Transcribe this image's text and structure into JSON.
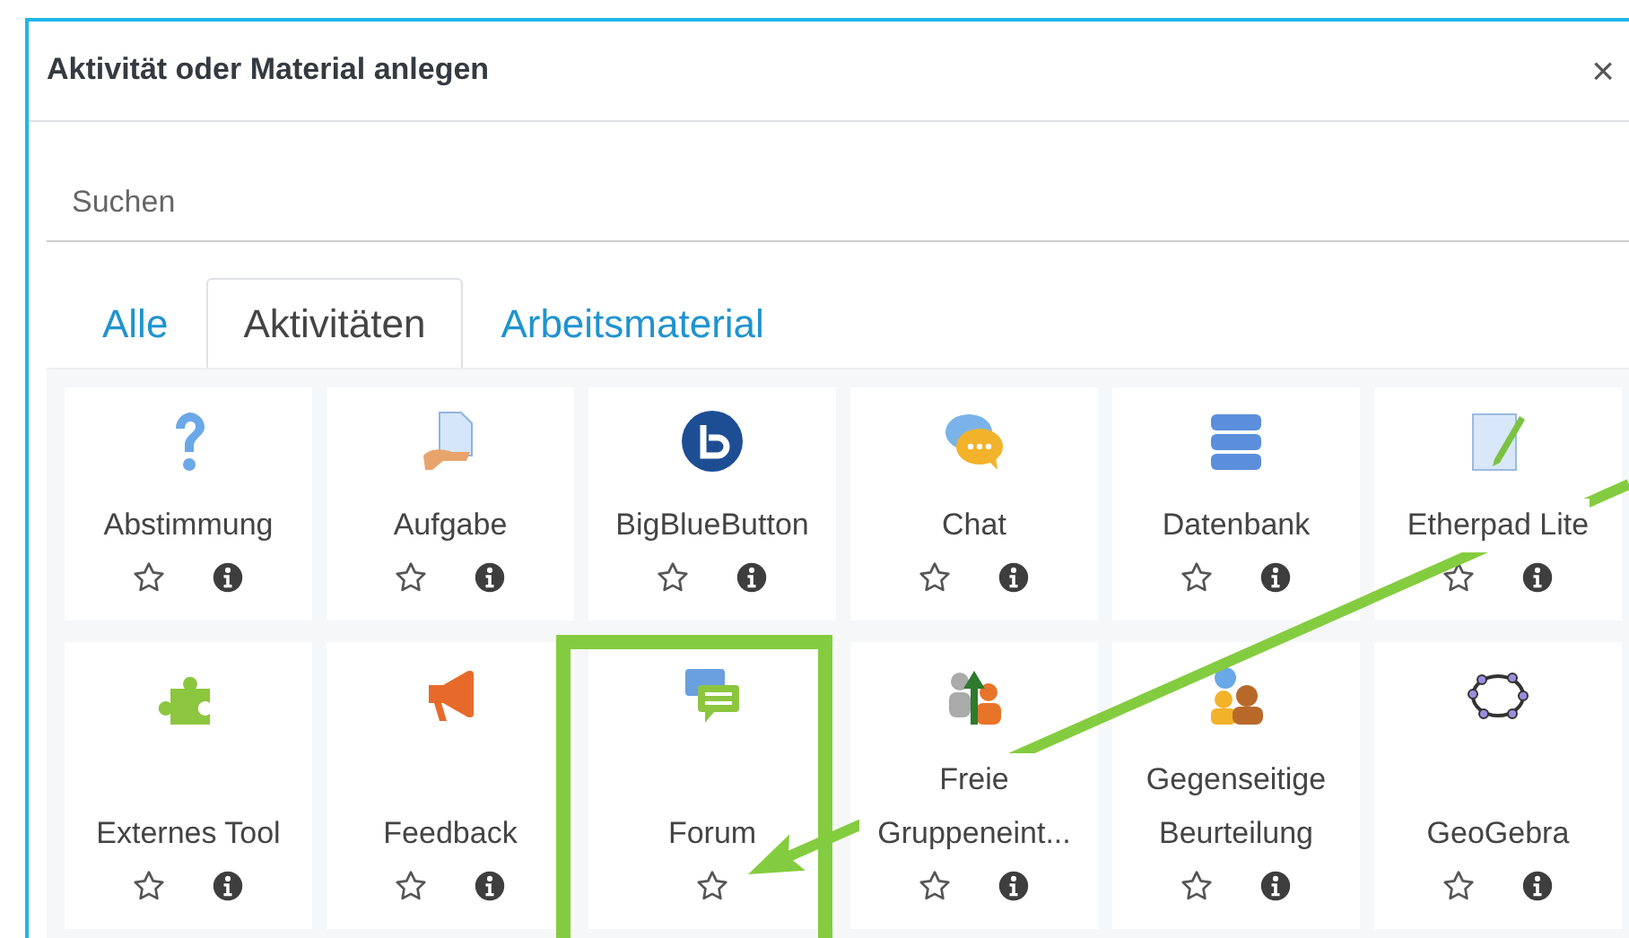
{
  "dialog": {
    "title": "Aktivität oder Material anlegen",
    "close": "×"
  },
  "search": {
    "placeholder": "Suchen"
  },
  "tabs": [
    {
      "label": "Alle",
      "selected": false
    },
    {
      "label": "Aktivitäten",
      "selected": true
    },
    {
      "label": "Arbeitsmaterial",
      "selected": false
    }
  ],
  "items": [
    {
      "label": "Abstimmung",
      "kind": "question",
      "info": true,
      "highlighted": false
    },
    {
      "label": "Aufgabe",
      "kind": "assign",
      "info": true,
      "highlighted": false
    },
    {
      "label": "BigBlueButton",
      "kind": "bbb",
      "info": true,
      "highlighted": false
    },
    {
      "label": "Chat",
      "kind": "chat",
      "info": true,
      "highlighted": false
    },
    {
      "label": "Datenbank",
      "kind": "database",
      "info": true,
      "highlighted": false
    },
    {
      "label": "Etherpad Lite",
      "kind": "etherpad",
      "info": true,
      "highlighted": false
    },
    {
      "label": "Externes Tool",
      "kind": "puzzle",
      "info": true,
      "highlighted": false
    },
    {
      "label": "Feedback",
      "kind": "megaphone",
      "info": true,
      "highlighted": false
    },
    {
      "label": "Forum",
      "kind": "forum",
      "info": false,
      "highlighted": true
    },
    {
      "label": "Freie Gruppeneint...",
      "kind": "groups",
      "info": true,
      "highlighted": false
    },
    {
      "label": "Gegenseitige Beurteilung",
      "kind": "peers",
      "info": true,
      "highlighted": false
    },
    {
      "label": "GeoGebra",
      "kind": "geogebra",
      "info": true,
      "highlighted": false
    }
  ]
}
